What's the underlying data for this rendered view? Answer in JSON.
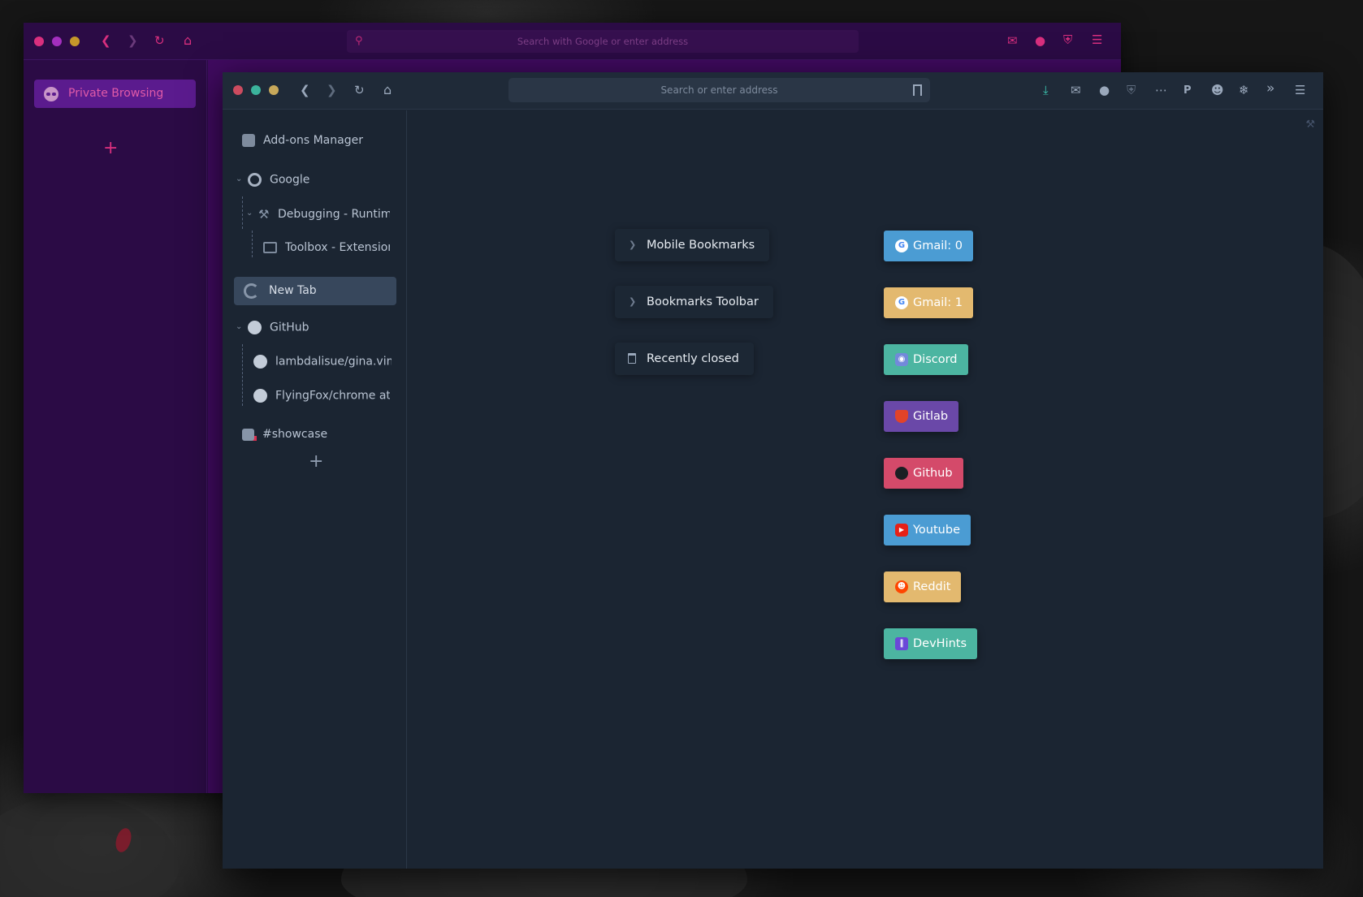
{
  "colors": {
    "private_bg": "#2b0b45",
    "private_accent": "#d92f7e",
    "front_bg": "#1b2532",
    "front_toolbar": "#1f2a38"
  },
  "private_window": {
    "toolbar": {
      "traffic_lights": [
        "#d92f7e",
        "#a42fbe",
        "#c5982a"
      ],
      "icons": [
        "back-icon",
        "forward-icon",
        "reload-icon",
        "home-icon"
      ],
      "url_placeholder": "Search with Google or enter address",
      "right_icons": [
        "inbox-icon",
        "account-icon",
        "shield-icon",
        "menu-icon"
      ]
    },
    "sidebar": {
      "private_pill_label": "Private Browsing",
      "add_tab_label": "+"
    }
  },
  "main_window": {
    "toolbar": {
      "traffic_lights": [
        "#cc4b5f",
        "#3bb39c",
        "#c7a85a"
      ],
      "icons": [
        "back-icon",
        "forward-icon",
        "reload-icon",
        "home-icon"
      ],
      "url_placeholder": "Search or enter address",
      "right_icons": [
        "download-icon",
        "inbox-icon",
        "account-icon",
        "shield-icon",
        "more-icon",
        "pocket-icon",
        "ghost-icon",
        "plugin-icon",
        "overflow-icon",
        "menu-icon"
      ]
    },
    "sidebar": {
      "items": [
        {
          "label": "Add-ons Manager",
          "icon": "puzzle-icon"
        },
        {
          "label": "Google",
          "icon": "google-icon",
          "expanded": true
        },
        {
          "label": "Debugging - Runtime /",
          "icon": "wrench-icon",
          "expanded": true
        },
        {
          "label": "Toolbox - Extension /",
          "icon": "window-icon"
        },
        {
          "label": "New Tab",
          "icon": "firefox-icon",
          "active": true
        },
        {
          "label": "GitHub",
          "icon": "github-icon",
          "expanded": true
        },
        {
          "label": "lambdalisue/gina.vim:",
          "icon": "github-icon"
        },
        {
          "label": "FlyingFox/chrome at m",
          "icon": "github-icon"
        },
        {
          "label": "#showcase",
          "icon": "chat-icon"
        }
      ],
      "add_tab_label": "+"
    },
    "new_tab": {
      "folders": [
        {
          "label": "Mobile Bookmarks",
          "icon": "chevron-right-icon"
        },
        {
          "label": "Bookmarks Toolbar",
          "icon": "chevron-right-icon"
        },
        {
          "label": "Recently closed",
          "icon": "trash-icon"
        }
      ],
      "bookmarks": [
        {
          "label": "Gmail: 0",
          "icon": "google-icon",
          "color": "#4b9cd3"
        },
        {
          "label": "Gmail: 1",
          "icon": "google-icon",
          "color": "#e3b96f"
        },
        {
          "label": "Discord",
          "icon": "discord-icon",
          "color": "#4cb5a1"
        },
        {
          "label": "Gitlab",
          "icon": "gitlab-icon",
          "color": "#6a48a8"
        },
        {
          "label": "Github",
          "icon": "github-icon",
          "color": "#d44a6a"
        },
        {
          "label": "Youtube",
          "icon": "youtube-icon",
          "color": "#4b9cd3"
        },
        {
          "label": "Reddit",
          "icon": "reddit-icon",
          "color": "#e3b96f"
        },
        {
          "label": "DevHints",
          "icon": "devhints-icon",
          "color": "#4cb5a1"
        }
      ]
    }
  }
}
